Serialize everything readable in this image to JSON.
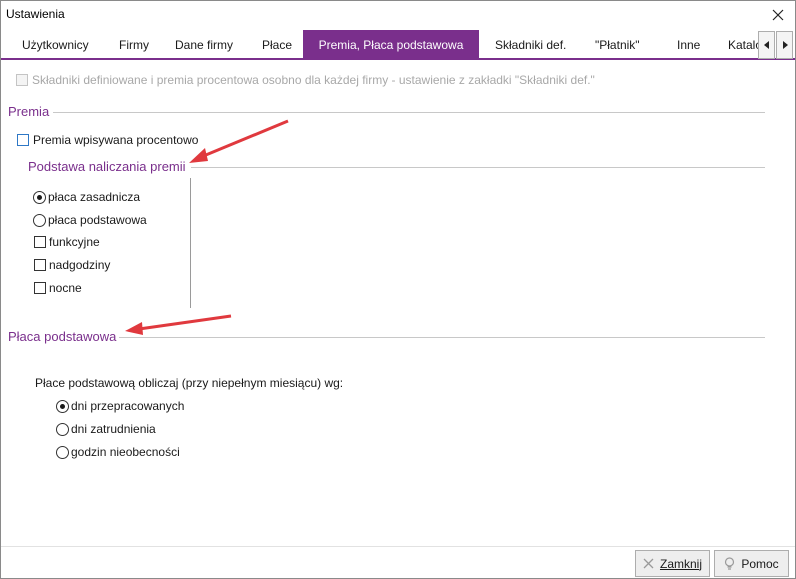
{
  "window": {
    "title": "Ustawienia"
  },
  "tabs": [
    {
      "label": "Użytkownicy"
    },
    {
      "label": "Firmy"
    },
    {
      "label": "Dane firmy"
    },
    {
      "label": "Płace"
    },
    {
      "label": "Premia, Płaca podstawowa"
    },
    {
      "label": "Składniki def."
    },
    {
      "label": "\"Płatnik\""
    },
    {
      "label": "Inne"
    },
    {
      "label": "Katalo"
    }
  ],
  "active_tab": "Premia, Płaca podstawowa",
  "disabled_option": {
    "label": "Składniki definiowane i premia procentowa osobno dla każdej firmy - ustawienie z zakładki \"Składniki def.\""
  },
  "premia": {
    "title": "Premia",
    "checkbox_label": "Premia wpisywana procentowo",
    "basis": {
      "title": "Podstawa naliczania premii",
      "radios": [
        {
          "label": "płaca zasadnicza",
          "selected": true
        },
        {
          "label": "płaca podstawowa",
          "selected": false
        }
      ],
      "checkboxes": [
        {
          "label": "funkcyjne",
          "checked": false
        },
        {
          "label": "nadgodziny",
          "checked": false
        },
        {
          "label": "nocne",
          "checked": false
        }
      ]
    }
  },
  "placa": {
    "title": "Płaca podstawowa",
    "instruction": "Płace podstawową obliczaj (przy niepełnym miesiącu) wg:",
    "radios": [
      {
        "label": "dni przepracowanych",
        "selected": true
      },
      {
        "label": "dni zatrudnienia",
        "selected": false
      },
      {
        "label": "godzin nieobecności",
        "selected": false
      }
    ]
  },
  "footer": {
    "close_label": "Zamknij",
    "help_label": "Pomoc"
  },
  "colors": {
    "accent": "#7a2f8c",
    "annotation_arrow": "#e0393e"
  }
}
